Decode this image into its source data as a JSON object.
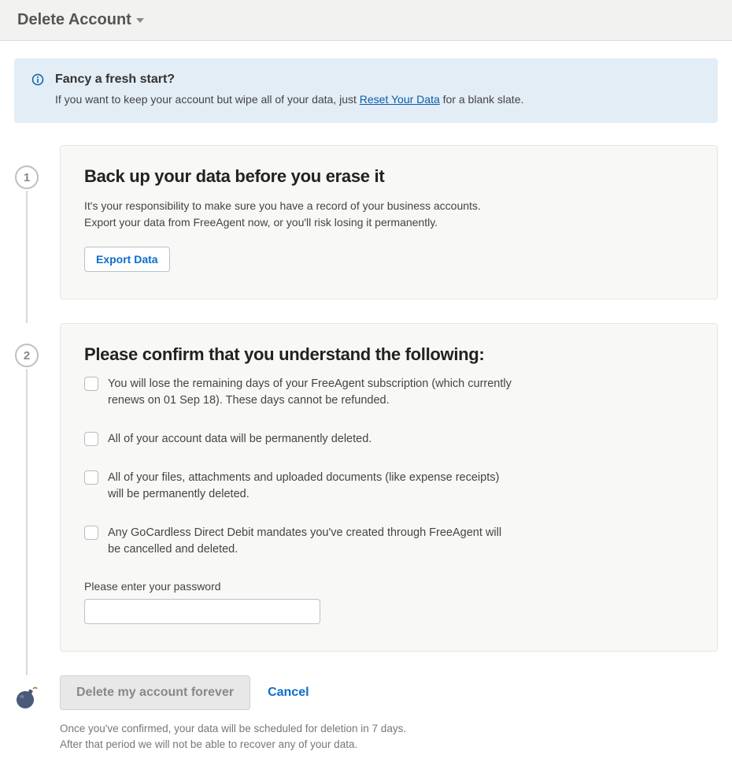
{
  "header": {
    "title": "Delete Account"
  },
  "banner": {
    "title": "Fancy a fresh start?",
    "body_prefix": "If you want to keep your account but wipe all of your data, just ",
    "link_text": "Reset Your Data",
    "body_suffix": " for a blank slate."
  },
  "step1": {
    "marker": "1",
    "title": "Back up your data before you erase it",
    "line1": "It's your responsibility to make sure you have a record of your business accounts.",
    "line2": "Export your data from FreeAgent now, or you'll risk losing it permanently.",
    "button": "Export Data"
  },
  "step2": {
    "marker": "2",
    "title": "Please confirm that you understand the following:",
    "items": [
      "You will lose the remaining days of your FreeAgent subscription (which currently renews on 01 Sep 18). These days cannot be refunded.",
      "All of your account data will be permanently deleted.",
      "All of your files, attachments and uploaded documents (like expense receipts) will be permanently deleted.",
      "Any GoCardless Direct Debit mandates you've created through FreeAgent will be cancelled and deleted."
    ],
    "password_label": "Please enter your password"
  },
  "final": {
    "delete_button": "Delete my account forever",
    "cancel": "Cancel",
    "warn1": "Once you've confirmed, your data will be scheduled for deletion in 7 days.",
    "warn2": "After that period we will not be able to recover any of your data."
  }
}
